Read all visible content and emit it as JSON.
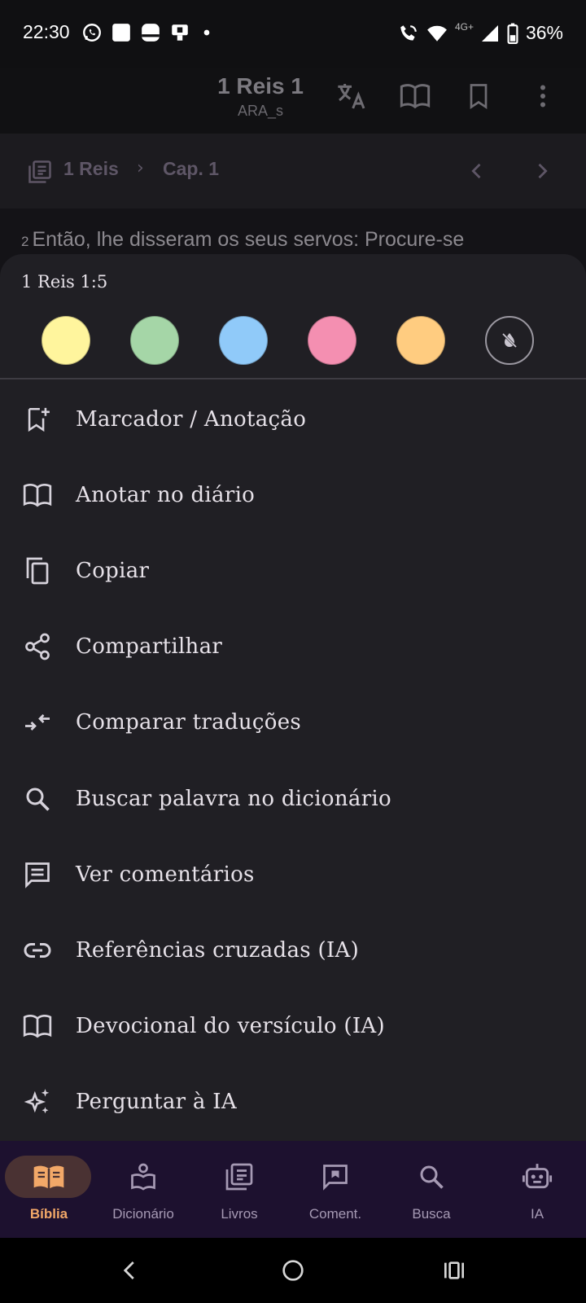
{
  "status_bar": {
    "time": "22:30",
    "network": "4G+",
    "battery": "36%",
    "icons_left": [
      "whatsapp-icon",
      "app-square-icon",
      "app-rounded-icon",
      "app-trolley-icon",
      "dot-icon"
    ],
    "icons_right": [
      "wifi-call-icon",
      "wifi-icon",
      "signal-icon",
      "battery-icon"
    ]
  },
  "app_bar": {
    "title": "1 Reis 1",
    "subtitle": "ARA_s",
    "actions": [
      "translate-icon",
      "journal-book-icon",
      "bookmark-icon",
      "more-vert-icon"
    ]
  },
  "nav": {
    "book": "1 Reis",
    "separator": "›",
    "chapter": "Cap. 1"
  },
  "verse_preview": {
    "number": "2",
    "text": "Então, lhe disseram os seus servos: Procure-se"
  },
  "sheet": {
    "reference": "1 Reis 1:5",
    "highlight_colors": [
      {
        "name": "yellow",
        "color": "#fff59d"
      },
      {
        "name": "green",
        "color": "#a5d6a7"
      },
      {
        "name": "blue",
        "color": "#90caf9"
      },
      {
        "name": "pink",
        "color": "#f48fb1"
      },
      {
        "name": "orange",
        "color": "#ffcc80"
      }
    ],
    "clear_icon": "format-color-reset-icon",
    "menu": [
      {
        "label": "Marcador / Anotação",
        "icon": "bookmark-add-icon"
      },
      {
        "label": "Anotar no diário",
        "icon": "open-book-icon"
      },
      {
        "label": "Copiar",
        "icon": "copy-icon"
      },
      {
        "label": "Compartilhar",
        "icon": "share-icon"
      },
      {
        "label": "Comparar traduções",
        "icon": "compare-arrows-icon"
      },
      {
        "label": "Buscar palavra no dicionário",
        "icon": "search-icon"
      },
      {
        "label": "Ver comentários",
        "icon": "comment-icon"
      },
      {
        "label": "Referências cruzadas (IA)",
        "icon": "link-icon"
      },
      {
        "label": "Devocional do versículo (IA)",
        "icon": "open-book-icon"
      },
      {
        "label": "Perguntar à IA",
        "icon": "sparkles-icon"
      }
    ]
  },
  "bottom_nav": {
    "items": [
      {
        "label": "Bíblia",
        "icon": "book-open-icon",
        "active": true
      },
      {
        "label": "Dicionário",
        "icon": "dictionary-icon",
        "active": false
      },
      {
        "label": "Livros",
        "icon": "library-icon",
        "active": false
      },
      {
        "label": "Coment.",
        "icon": "comment-flag-icon",
        "active": false
      },
      {
        "label": "Busca",
        "icon": "search-icon",
        "active": false
      },
      {
        "label": "IA",
        "icon": "robot-icon",
        "active": false
      }
    ],
    "active_color": "#f2a868"
  },
  "system_nav": [
    "back-icon",
    "home-icon",
    "recents-icon"
  ]
}
